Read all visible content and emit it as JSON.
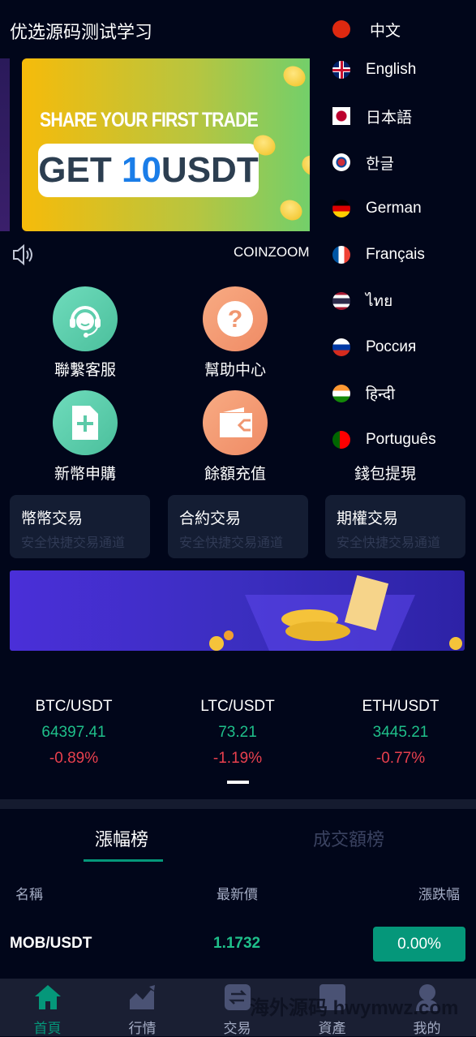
{
  "header": {
    "title": "优选源码测试学习"
  },
  "banner": {
    "line1": "SHARE YOUR FIRST TRADE",
    "get": "GET ",
    "amount": "10",
    "unit": "USDT"
  },
  "notice": {
    "text": "COINZOOM"
  },
  "features": [
    {
      "label": "聯繫客服",
      "icon": "headset-icon"
    },
    {
      "label": "幫助中心",
      "icon": "question-icon"
    },
    {
      "label": "新幣申購",
      "icon": "document-plus-icon"
    },
    {
      "label": "餘額充值",
      "icon": "wallet-icon"
    },
    {
      "label": "錢包提現",
      "icon": "withdraw-icon"
    }
  ],
  "cards": [
    {
      "title": "幣幣交易",
      "sub": "安全快捷交易通道"
    },
    {
      "title": "合約交易",
      "sub": "安全快捷交易通道"
    },
    {
      "title": "期權交易",
      "sub": "安全快捷交易通道"
    }
  ],
  "tickers": [
    {
      "pair": "BTC/USDT",
      "price": "64397.41",
      "change": "-0.89%"
    },
    {
      "pair": "LTC/USDT",
      "price": "73.21",
      "change": "-1.19%"
    },
    {
      "pair": "ETH/USDT",
      "price": "3445.21",
      "change": "-0.77%"
    }
  ],
  "tabs": {
    "active": "漲幅榜",
    "inactive": "成交額榜"
  },
  "table": {
    "headers": [
      "名稱",
      "最新價",
      "漲跌幅"
    ],
    "rows": [
      {
        "pair": "MOB/USDT",
        "price": "1.1732",
        "change": "0.00%"
      }
    ]
  },
  "nav": [
    {
      "label": "首頁",
      "icon": "home-icon",
      "active": true
    },
    {
      "label": "行情",
      "icon": "chart-icon"
    },
    {
      "label": "交易",
      "icon": "exchange-icon"
    },
    {
      "label": "資產",
      "icon": "assets-icon"
    },
    {
      "label": "我的",
      "icon": "user-icon"
    }
  ],
  "watermark": "海外源码 hwymwz.com",
  "languages": [
    "中文",
    "English",
    "日本語",
    "한글",
    "German",
    "Français",
    "ไทย",
    "Россия",
    "हिन्दी",
    "Português"
  ],
  "colors": {
    "accent": "#05977a",
    "up": "#1fbf8a",
    "down": "#e8404e",
    "background": "#01061a"
  }
}
